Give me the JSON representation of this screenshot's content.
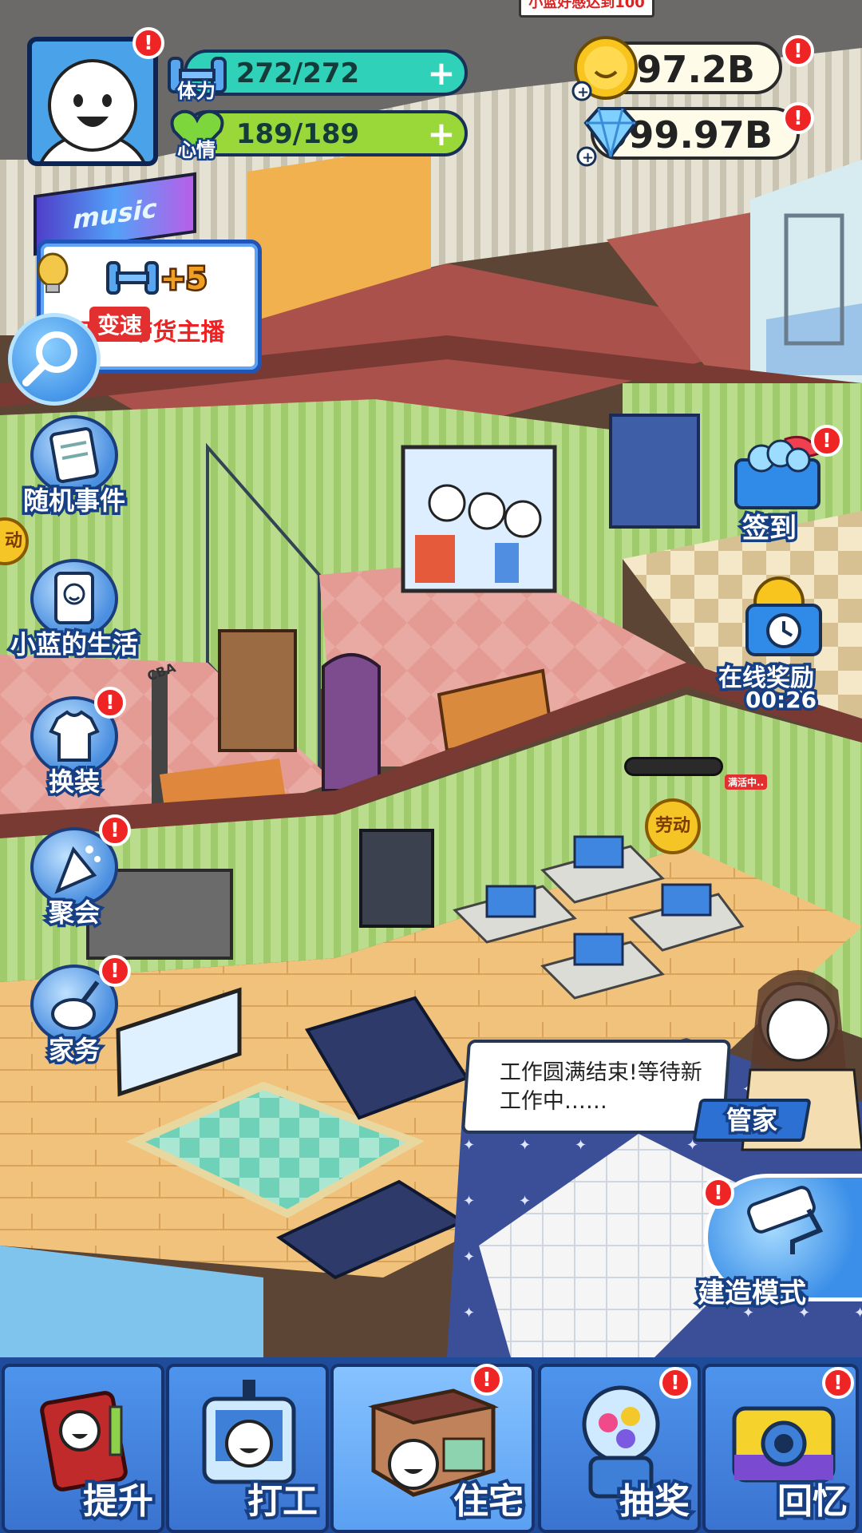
{
  "player": {
    "stamina_label": "体力",
    "stamina_value": "272/272",
    "mood_label": "心情",
    "mood_value": "189/189"
  },
  "currency": {
    "coins": "997.2B",
    "gems": "999.97B"
  },
  "top_banner": "小蓝好感达到100",
  "music_sign": "music",
  "quest_card": {
    "reward": "+5",
    "text": "打工-带货主播",
    "speed_tag": "变速"
  },
  "side_left": {
    "random_event": "随机事件",
    "xiaolan_life": "小蓝的生活",
    "outfit": "换装",
    "party": "聚会",
    "housework": "家务",
    "labor_edge": "动"
  },
  "side_right": {
    "sign_in": "签到",
    "online_reward": "在线奖励",
    "online_timer": "00:26",
    "build_mode": "建造模式"
  },
  "scene_tags": {
    "labor": "劳动",
    "recharging": "满活中..",
    "cba": "CBA"
  },
  "butler": {
    "label": "管家",
    "dialog": "工作圆满结束!等待新工作中……"
  },
  "badges": {
    "mark": "!"
  },
  "bottom_nav": [
    "提升",
    "打工",
    "住宅",
    "抽奖",
    "回忆"
  ],
  "colors": {
    "stamina_bar": "#2fd1b8",
    "mood_bar": "#9ad83a",
    "nav_bg": "#1f4c9a",
    "badge_red": "#ef2424",
    "outline_navy": "#173f83"
  }
}
